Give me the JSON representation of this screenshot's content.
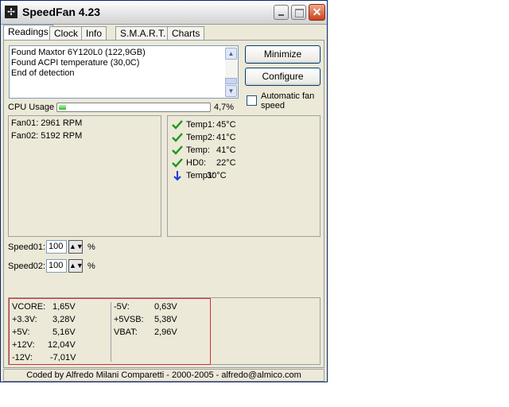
{
  "window": {
    "title": "SpeedFan 4.23"
  },
  "tabs": [
    {
      "label": "Readings",
      "active": true
    },
    {
      "label": "Clock",
      "active": false
    },
    {
      "label": "Info",
      "active": false
    },
    {
      "label": "S.M.A.R.T.",
      "active": false
    },
    {
      "label": "Charts",
      "active": false
    }
  ],
  "log": {
    "lines": [
      "Found Maxtor 6Y120L0 (122,9GB)",
      "Found ACPI temperature (30,0C)",
      "End of detection"
    ]
  },
  "buttons": {
    "minimize": "Minimize",
    "configure": "Configure"
  },
  "auto_fan": {
    "label": "Automatic fan speed",
    "checked": false
  },
  "cpu": {
    "label": "CPU Usage",
    "value": "4,7%",
    "percent": 4.7
  },
  "fans": [
    {
      "text": "Fan01: 2961 RPM"
    },
    {
      "text": "Fan02: 5192 RPM"
    }
  ],
  "temps": [
    {
      "label": "Temp1:",
      "value": "45°C",
      "status": "ok",
      "icon": "checkmark-icon"
    },
    {
      "label": "Temp2:",
      "value": "41°C",
      "status": "ok",
      "icon": "checkmark-icon"
    },
    {
      "label": "Temp:",
      "value": "41°C",
      "status": "ok",
      "icon": "checkmark-icon"
    },
    {
      "label": "HD0:",
      "value": "22°C",
      "status": "ok",
      "icon": "checkmark-icon"
    },
    {
      "label": "Temp1:",
      "value": "30°C",
      "status": "down",
      "icon": "arrow-down-icon"
    }
  ],
  "speeds": [
    {
      "label": "Speed01:",
      "value": "100",
      "unit": "%"
    },
    {
      "label": "Speed02:",
      "value": "100",
      "unit": "%"
    }
  ],
  "voltages": {
    "left": [
      {
        "name": "VCORE:",
        "value": "1,65V"
      },
      {
        "name": "+3.3V:",
        "value": "3,28V"
      },
      {
        "name": "+5V:",
        "value": "5,16V"
      },
      {
        "name": "+12V:",
        "value": "12,04V"
      },
      {
        "name": "-12V:",
        "value": "-7,01V"
      }
    ],
    "right": [
      {
        "name": "-5V:",
        "value": "0,63V"
      },
      {
        "name": "+5VSB:",
        "value": "5,38V"
      },
      {
        "name": "VBAT:",
        "value": "2,96V"
      }
    ]
  },
  "status": {
    "text": "Coded by Alfredo Milani Comparetti - 2000-2005 - alfredo@almico.com"
  },
  "colors": {
    "check": "#1a9a1a",
    "arrow": "#1a3fd6",
    "selection_border": "#d03030",
    "cpu_fill": "#2fc02f"
  }
}
